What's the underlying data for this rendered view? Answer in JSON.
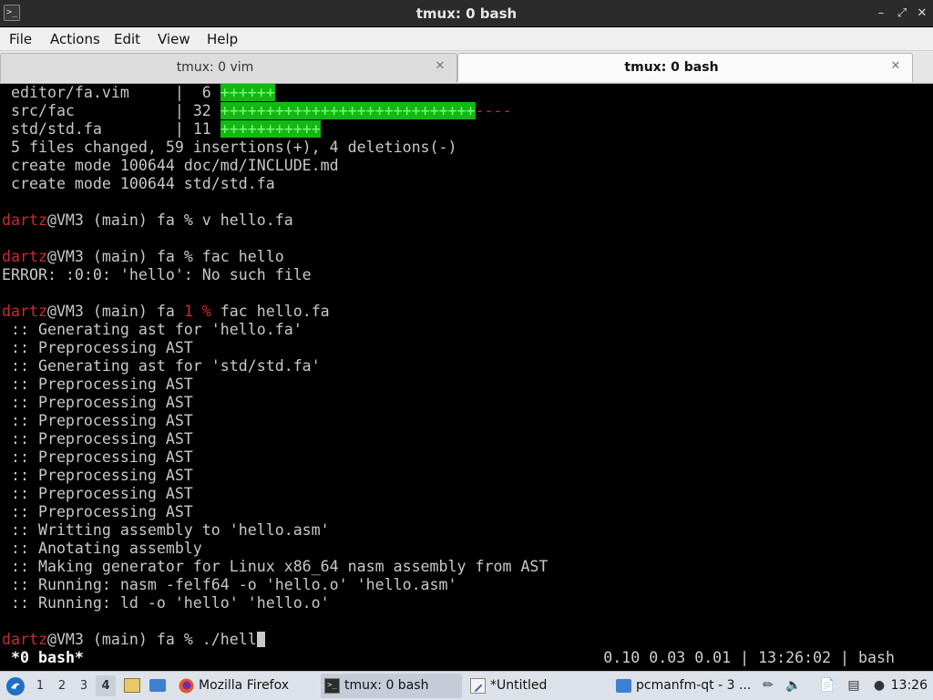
{
  "window": {
    "title": "tmux: 0 bash"
  },
  "menu": {
    "items": [
      "File",
      "Actions",
      "Edit",
      "View",
      "Help"
    ]
  },
  "tabs": [
    {
      "label": "tmux: 0 vim"
    },
    {
      "label": "tmux: 0 bash"
    }
  ],
  "terminal": {
    "diffstat": [
      {
        "file": " editor/fa.vim     ",
        "sep": "| ",
        "count": " 6",
        "plus": "++++++",
        "minus": ""
      },
      {
        "file": " src/fac           ",
        "sep": "| ",
        "count": "32",
        "plus": "++++++++++++++++++++++++++++",
        "minus": "----"
      },
      {
        "file": " std/std.fa        ",
        "sep": "| ",
        "count": "11",
        "plus": "+++++++++++",
        "minus": ""
      }
    ],
    "summary": " 5 files changed, 59 insertions(+), 4 deletions(-)",
    "create1": " create mode 100644 doc/md/INCLUDE.md",
    "create2": " create mode 100644 std/std.fa",
    "prompt_user": "dartz",
    "prompt_rest": "@VM3 (main) fa ",
    "prompt_end": "% ",
    "cmd1": "v hello.fa",
    "cmd2": "fac hello",
    "error": "ERROR: :0:0: 'hello': No such file",
    "exit_code": "1 ",
    "exit_prompt_end": "%",
    "cmd3": " fac hello.fa",
    "output": [
      " :: Generating ast for 'hello.fa'",
      " :: Preprocessing AST",
      " :: Generating ast for 'std/std.fa'",
      " :: Preprocessing AST",
      " :: Preprocessing AST",
      " :: Preprocessing AST",
      " :: Preprocessing AST",
      " :: Preprocessing AST",
      " :: Preprocessing AST",
      " :: Preprocessing AST",
      " :: Preprocessing AST",
      " :: Writting assembly to 'hello.asm'",
      " :: Anotating assembly",
      " :: Making generator for Linux x86_64 nasm assembly from AST",
      " :: Running: nasm -felf64 -o 'hello.o' 'hello.asm'",
      " :: Running: ld -o 'hello' 'hello.o'"
    ],
    "current_input": "./hell"
  },
  "tmux_status": {
    "left": "*0 bash*",
    "right": "0.10 0.03 0.01 | 13:26:02 | bash"
  },
  "taskbar": {
    "desktops": [
      "1",
      "2",
      "3",
      "4"
    ],
    "active_desktop": "4",
    "tasks": [
      {
        "label": "Mozilla Firefox",
        "icon": "firefox-icon"
      },
      {
        "label": "tmux: 0 bash",
        "icon": "terminal-icon"
      },
      {
        "label": "*Untitled",
        "icon": "text-editor-icon"
      },
      {
        "label": "pcmanfm-qt - 3 ...",
        "icon": "folder-icon"
      }
    ],
    "clock": "13:26"
  },
  "colors": {
    "prompt_user": "#cd2a2a",
    "diff_plus_bg": "#14b814",
    "diff_minus": "#cd2a2a",
    "terminal_bg": "#000000",
    "terminal_fg": "#c8c8c8"
  }
}
